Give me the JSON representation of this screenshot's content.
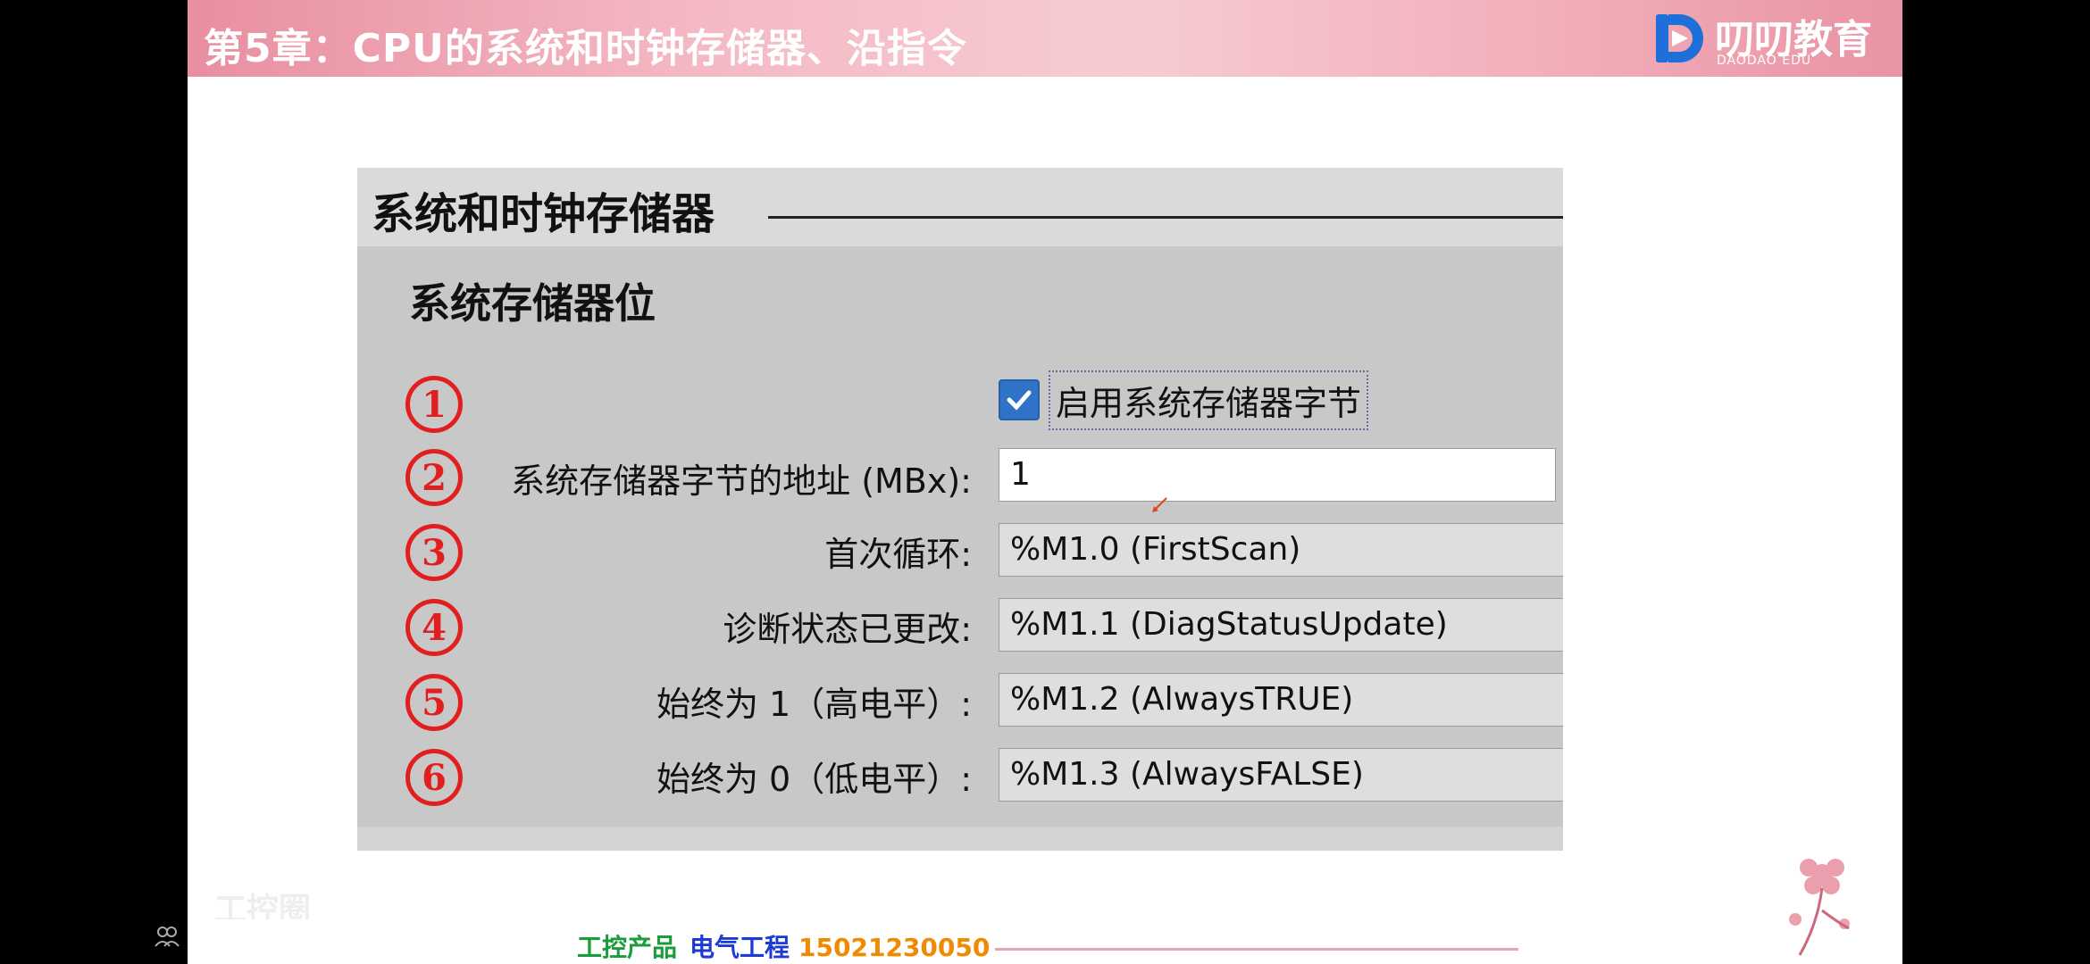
{
  "header": {
    "title": "第5章：CPU的系统和时钟存储器、沿指令",
    "logo_text": "叨叨教育",
    "logo_sub": "DAODAO EDU"
  },
  "panel": {
    "title": "系统和时钟存储器",
    "group_title": "系统存储器位",
    "checkbox": {
      "label": "启用系统存储器字节",
      "checked": true
    },
    "rows": [
      {
        "num": "1"
      },
      {
        "num": "2",
        "label": "系统存储器字节的地址 (MBx):",
        "value": "1"
      },
      {
        "num": "3",
        "label": "首次循环:",
        "value": "%M1.0 (FirstScan)"
      },
      {
        "num": "4",
        "label": "诊断状态已更改:",
        "value": "%M1.1 (DiagStatusUpdate)"
      },
      {
        "num": "5",
        "label": "始终为 1（高电平）:",
        "value": "%M1.2 (AlwaysTRUE)"
      },
      {
        "num": "6",
        "label": "始终为 0（低电平）:",
        "value": "%M1.3 (AlwaysFALSE)"
      }
    ]
  },
  "footer": {
    "part1": "工控产品",
    "part2": "电气工程",
    "phone": "15021230050",
    "watermark": "工控圈"
  },
  "colors": {
    "accent_red": "#e21f1f",
    "checkbox_blue": "#2f73c9",
    "footer_green": "#1a9c3a",
    "footer_blue": "#1d39d6",
    "footer_orange": "#f08a00"
  }
}
